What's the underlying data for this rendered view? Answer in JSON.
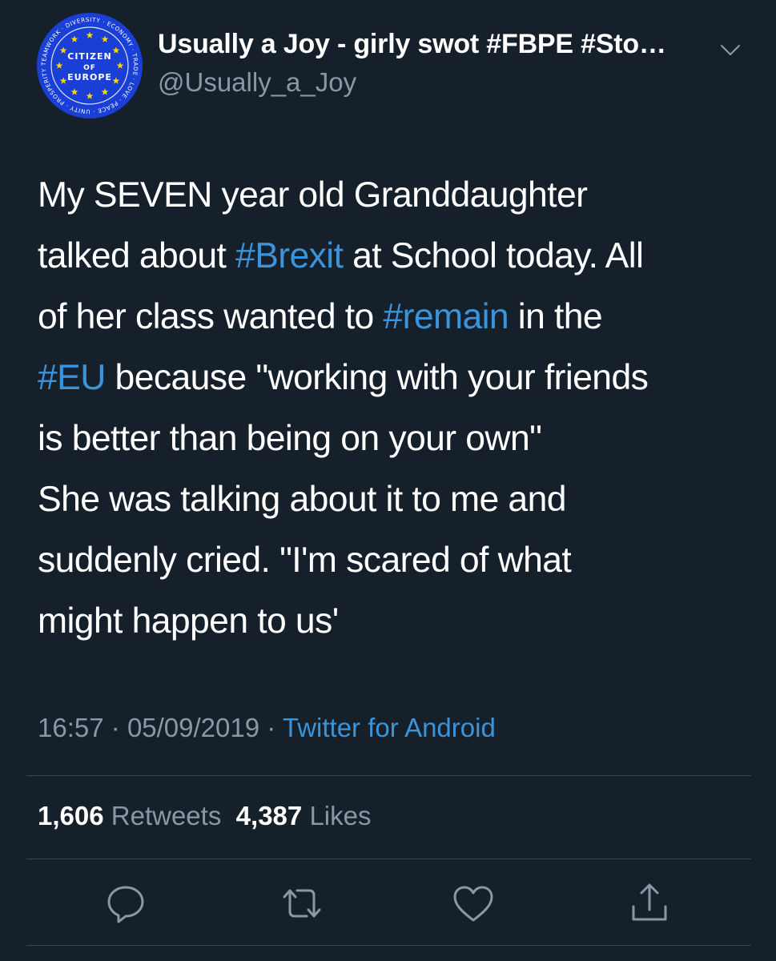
{
  "author": {
    "display_name": "Usually a Joy - girly swot #FBPE #Sto…",
    "handle": "@Usually_a_Joy",
    "avatar_text": {
      "top": "CITIZEN",
      "middle": "OF",
      "bottom": "EUROPE",
      "ring": "TEAMWORK · DIVERSITY · ECONOMY · TRADE · LOVE · PEACE · UNITY · PROSPERITY ·"
    }
  },
  "tweet": {
    "lines": [
      [
        {
          "text": "My SEVEN year old Granddaughter"
        }
      ],
      [
        {
          "text": "talked about "
        },
        {
          "text": "#Brexit",
          "hashtag": true
        },
        {
          "text": " at School today. All"
        }
      ],
      [
        {
          "text": "of her class wanted to "
        },
        {
          "text": "#remain",
          "hashtag": true
        },
        {
          "text": " in the"
        }
      ],
      [
        {
          "text": "#EU",
          "hashtag": true
        },
        {
          "text": " because \"working with your friends"
        }
      ],
      [
        {
          "text": "is better than being on your own\""
        }
      ],
      [
        {
          "text": "She was talking about it to me and"
        }
      ],
      [
        {
          "text": "suddenly cried. \"I'm scared of what"
        }
      ],
      [
        {
          "text": "might happen to us'"
        }
      ]
    ]
  },
  "meta": {
    "time": "16:57",
    "separator": "·",
    "date": "05/09/2019",
    "source": "Twitter for Android"
  },
  "stats": {
    "retweets_count": "1,606",
    "retweets_label": "Retweets",
    "likes_count": "4,387",
    "likes_label": "Likes"
  },
  "icons": {
    "reply": "reply-icon",
    "retweet": "retweet-icon",
    "like": "heart-icon",
    "share": "share-icon",
    "more": "chevron-down-icon"
  },
  "colors": {
    "background": "#15202b",
    "text": "#ffffff",
    "secondary": "#8899a6",
    "link": "#3b94d9",
    "divider": "#38444d",
    "avatar_blue": "#1a3fd6",
    "avatar_star": "#ffd500"
  }
}
